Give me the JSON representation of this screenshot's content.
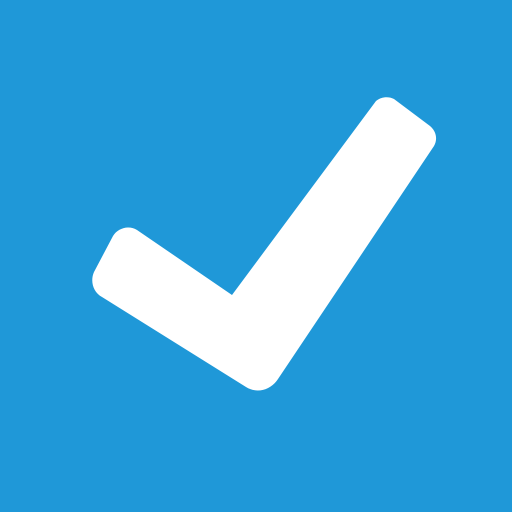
{
  "icon": {
    "name": "checkmark-icon",
    "background_color": "#1F98D8",
    "foreground_color": "#FFFFFF"
  }
}
